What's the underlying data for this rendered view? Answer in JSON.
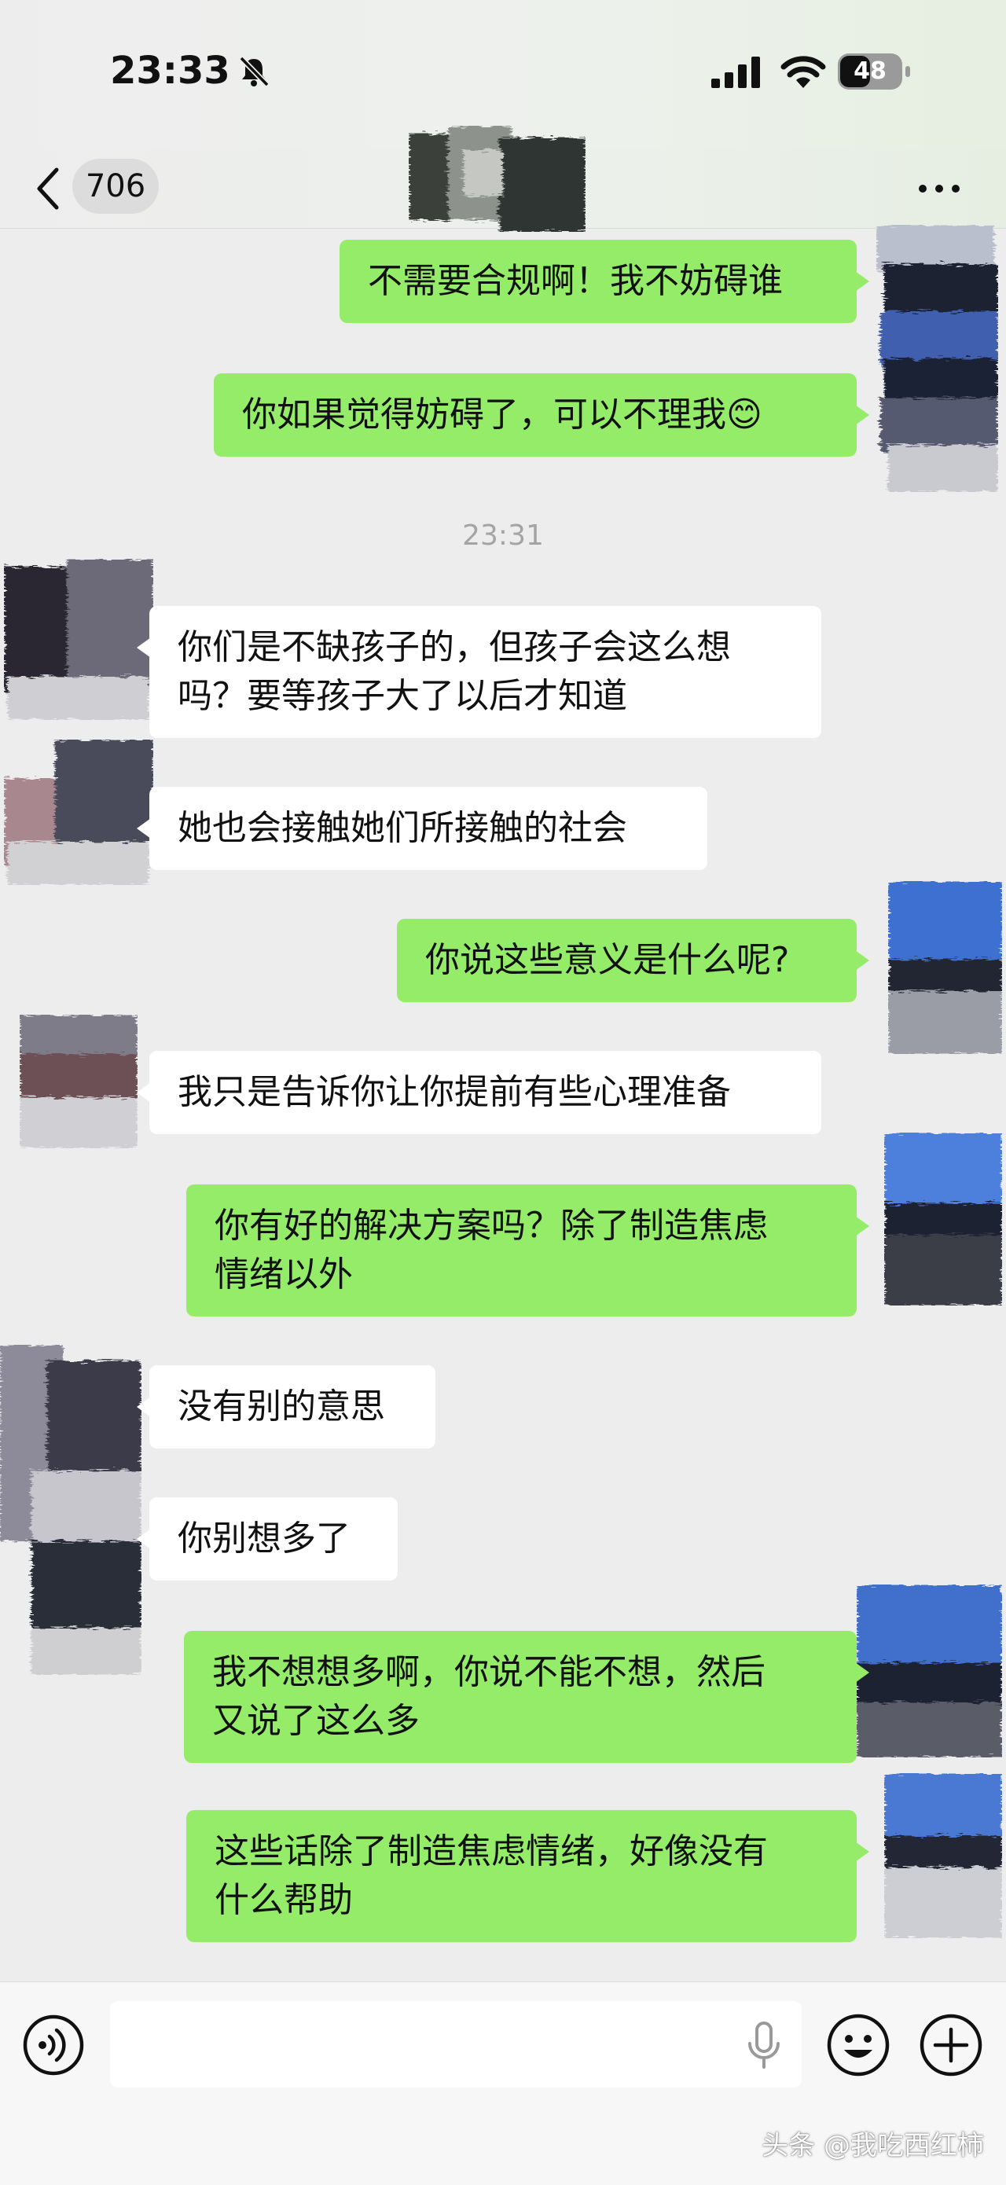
{
  "status_bar": {
    "time": "23:33",
    "battery_level": "48",
    "icons": [
      "bell-muted-icon",
      "cellular-signal-icon",
      "wifi-icon",
      "battery-icon"
    ]
  },
  "header": {
    "unread_count": "706",
    "icons": [
      "chevron-left-icon",
      "more-icon"
    ]
  },
  "messages": [
    {
      "side": "me",
      "text": "不需要合规啊！我不妨碍谁"
    },
    {
      "side": "me",
      "text": "你如果觉得妨碍了，可以不理我😊"
    },
    {
      "type": "time",
      "text": "23:31"
    },
    {
      "side": "them",
      "text": "你们是不缺孩子的，但孩子会这么想\n吗？要等孩子大了以后才知道"
    },
    {
      "side": "them",
      "text": "她也会接触她们所接触的社会"
    },
    {
      "side": "me",
      "text": "你说这些意义是什么呢?"
    },
    {
      "side": "them",
      "text": "我只是告诉你让你提前有些心理准备"
    },
    {
      "side": "me",
      "text": "你有好的解决方案吗？除了制造焦虑\n情绪以外"
    },
    {
      "side": "them",
      "text": "没有别的意思"
    },
    {
      "side": "them",
      "text": "你别想多了"
    },
    {
      "side": "me",
      "text": "我不想想多啊，你说不能不想，然后\n又说了这么多"
    },
    {
      "side": "me",
      "text": "这些话除了制造焦虑情绪，好像没有\n什么帮助"
    }
  ],
  "input_bar": {
    "value": "",
    "icons": [
      "voice-icon",
      "mic-icon",
      "emoji-icon",
      "plus-icon"
    ]
  },
  "watermark": "头条 @我吃西红柿",
  "colors": {
    "my_bubble": "#95ec69",
    "their_bubble": "#ffffff",
    "background": "#ededed"
  }
}
